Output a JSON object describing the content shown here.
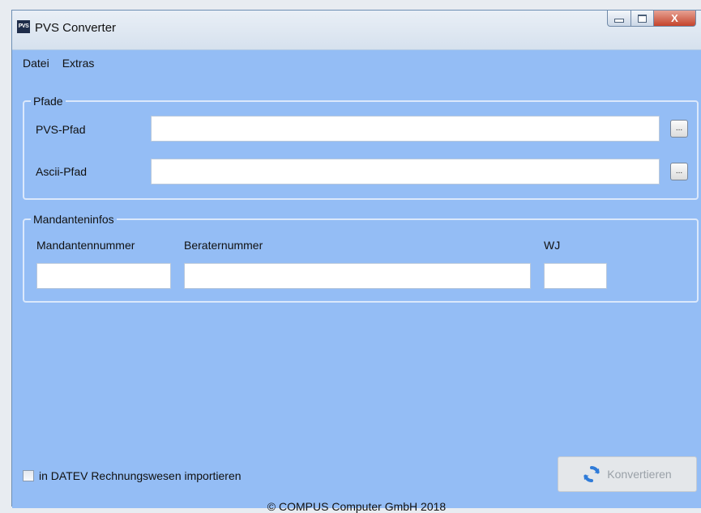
{
  "window": {
    "title": "PVS Converter",
    "app_icon_text": "PVS",
    "close_glyph": "X"
  },
  "menu": {
    "items": [
      "Datei",
      "Extras"
    ]
  },
  "pfade": {
    "title": "Pfade",
    "pvs_label": "PVS-Pfad",
    "pvs_value": "",
    "ascii_label": "Ascii-Pfad",
    "ascii_value": "",
    "browse_label": "..."
  },
  "mandanteninfos": {
    "title": "Mandanteninfos",
    "mandantennummer_label": "Mandantennummer",
    "mandantennummer_value": "",
    "beraternummer_label": "Beraternummer",
    "beraternummer_value": "",
    "wj_label": "WJ",
    "wj_value": ""
  },
  "footer": {
    "import_checkbox_label": "in DATEV Rechnungswesen importieren",
    "import_checked": false,
    "convert_label": "Konvertieren",
    "convert_icon": "refresh-icon",
    "copyright": "© COMPUS Computer GmbH 2018"
  },
  "colors": {
    "client_bg": "#94bdf5",
    "group_border": "#dbe8fb",
    "refresh_icon_blue": "#2f7bd8"
  }
}
